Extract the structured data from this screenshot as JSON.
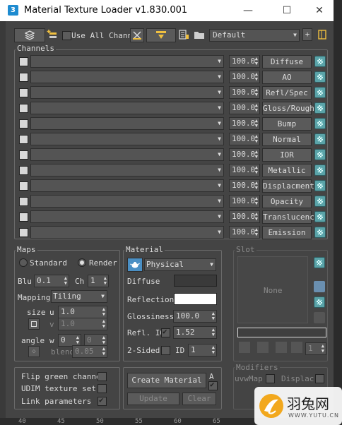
{
  "window": {
    "title": "Material Texture Loader v1.830.001",
    "minimize": "—",
    "maximize": "☐",
    "close": "✕"
  },
  "toolbar": {
    "use_all_channels_label": "Use All Channe",
    "preset_value": "Default",
    "add_label": "+"
  },
  "channels": {
    "group_label": "Channels",
    "items": [
      {
        "value": "100.0",
        "label": "Diffuse"
      },
      {
        "value": "100.0",
        "label": "AO"
      },
      {
        "value": "100.0",
        "label": "Refl/Spec"
      },
      {
        "value": "100.0",
        "label": "Gloss/Rough"
      },
      {
        "value": "100.0",
        "label": "Bump"
      },
      {
        "value": "100.0",
        "label": "Normal"
      },
      {
        "value": "100.0",
        "label": "IOR"
      },
      {
        "value": "100.0",
        "label": "Metallic"
      },
      {
        "value": "100.0",
        "label": "Displacment"
      },
      {
        "value": "100.0",
        "label": "Opacity"
      },
      {
        "value": "100.0",
        "label": "Translucency"
      },
      {
        "value": "100.0",
        "label": "Emission"
      }
    ]
  },
  "maps": {
    "group_label": "Maps",
    "standard_label": "Standard",
    "render_label": "Render",
    "blur_label": "Blu",
    "blur_value": "0.1",
    "ch_label": "Ch",
    "ch_value": "1",
    "mapping_label": "Mapping",
    "mapping_value": "Tiling",
    "size_label": "size",
    "u_label": "u",
    "u_value": "1.0",
    "v_label": "v",
    "v_value": "1.0",
    "angle_label": "angle",
    "w_label": "w",
    "angle_value1": "0",
    "angle_value2": "0",
    "blend_label": "blend",
    "blend_value": "0.05"
  },
  "material": {
    "group_label": "Material",
    "type_value": "Physical",
    "diffuse_label": "Diffuse",
    "diffuse_color": "#3a3a3a",
    "reflection_label": "Reflection",
    "reflection_color": "#ffffff",
    "glossiness_label": "Glossiness",
    "glossiness_value": "100.0",
    "refl_ior_label": "Refl. IO",
    "refl_ior_value": "1.52",
    "two_sided_label": "2-Sided",
    "id_label": "ID",
    "id_value": "1"
  },
  "slot": {
    "group_label": "Slot",
    "none_label": "None",
    "counter_value": "1"
  },
  "options": {
    "flip_green_label": "Flip green channel",
    "udim_label": "UDIM texture set",
    "link_params_label": "Link parameters"
  },
  "actions": {
    "create_material_label": "Create Material",
    "a_label": "A",
    "update_label": "Update",
    "clear_label": "Clear"
  },
  "modifiers": {
    "group_label": "Modifiers",
    "uvwmap_label": "uvwMap",
    "displace_label": "Displac"
  },
  "ruler": {
    "ticks": [
      "40",
      "45",
      "50",
      "55",
      "60",
      "65"
    ]
  },
  "watermark": {
    "brand": "羽兔网",
    "url": "WWW.YUTU.CN"
  },
  "colors": {
    "panel": "#444444",
    "accent_teal": "#5aa3a8"
  }
}
